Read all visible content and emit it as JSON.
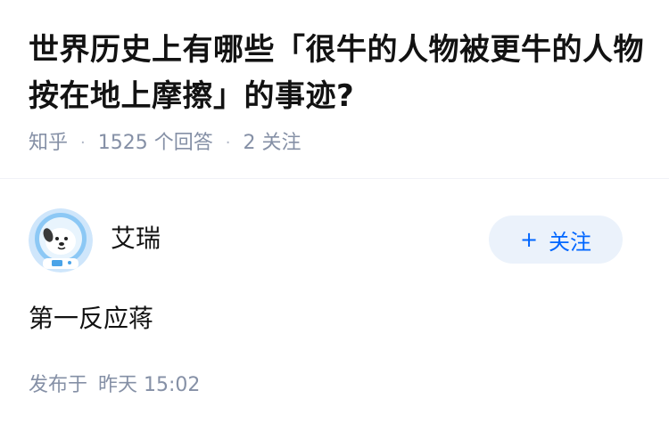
{
  "question": {
    "title": "世界历史上有哪些「很牛的人物被更牛的人物按在地上摩擦」的事迹?",
    "source": "知乎",
    "answer_count": "1525 个回答",
    "follower_count": "2 关注"
  },
  "answer": {
    "author": {
      "name": "艾瑞",
      "avatar_icon": "astronaut-dog-avatar"
    },
    "follow_label": "关注",
    "follow_icon": "plus-icon",
    "content": "第一反应蒋",
    "published_label": "发布于",
    "published_time": "昨天 15:02"
  },
  "colors": {
    "text_primary": "#121212",
    "text_secondary": "#8590a6",
    "accent": "#0066ff",
    "follow_bg": "#ebf2fb"
  }
}
